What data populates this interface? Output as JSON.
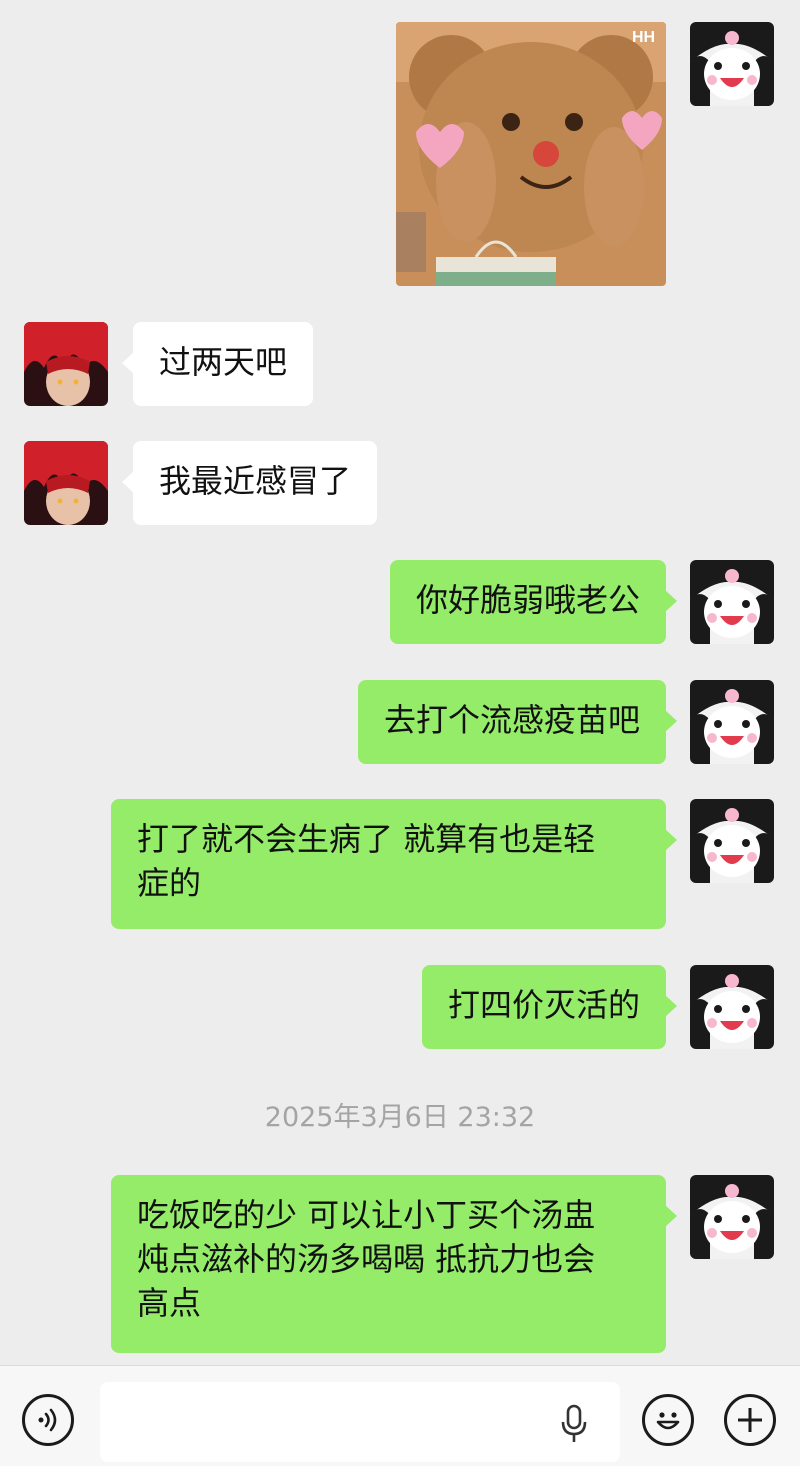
{
  "messages": [
    {
      "side": "out",
      "type": "image",
      "icon": "teddy-bear-photo"
    },
    {
      "side": "in",
      "text": "过两天吧"
    },
    {
      "side": "in",
      "text": "我最近感冒了"
    },
    {
      "side": "out",
      "text": "你好脆弱哦老公"
    },
    {
      "side": "out",
      "text": "去打个流感疫苗吧"
    },
    {
      "side": "out",
      "text": "打了就不会生病了 就算有也是轻\n症的"
    },
    {
      "side": "out",
      "text": "打四价灭活的"
    },
    {
      "side": "out",
      "text": "吃饭吃的少 可以让小丁买个汤盅\n炖点滋补的汤多喝喝 抵抗力也会\n高点"
    }
  ],
  "timestamp": "2025年3月6日 23:32",
  "photo_badge": "HH",
  "input_bar": {
    "voice_icon": "voice-icon",
    "mic_icon": "microphone-icon",
    "emoji_icon": "emoji-icon",
    "plus_icon": "plus-icon",
    "value": ""
  },
  "colors": {
    "background": "#ededed",
    "outgoing_bubble": "#95ec69",
    "incoming_bubble": "#ffffff",
    "timestamp": "#a4a4a4"
  }
}
